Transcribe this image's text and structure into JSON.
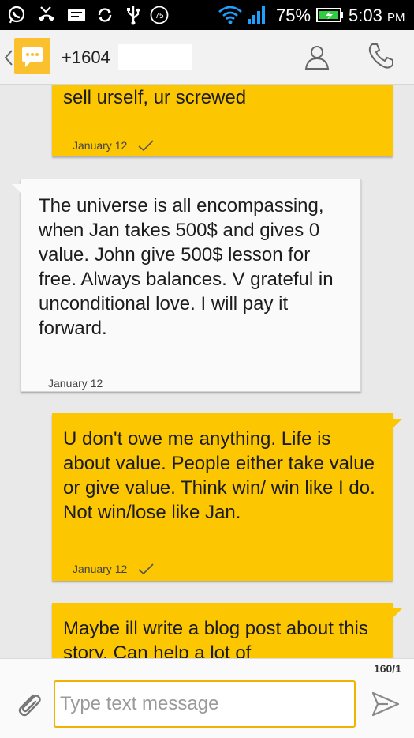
{
  "status_bar": {
    "notification_icons": [
      "whatsapp-icon",
      "missed-call-icon",
      "message-icon",
      "sync-icon",
      "usb-icon",
      "battery-level-badge-icon"
    ],
    "badge_value": "75",
    "battery_percent": "75%",
    "time": "5:03",
    "time_suffix": "PM"
  },
  "header": {
    "contact_number": "+1604",
    "icons": [
      "back-chevron-icon",
      "messaging-app-icon",
      "add-contact-icon",
      "phone-icon"
    ]
  },
  "messages": [
    {
      "direction": "outgoing",
      "text": "Persuasion and social skills. Can't sell urself, ur screwed",
      "date": "January 12",
      "delivered": true
    },
    {
      "direction": "incoming",
      "text": "The universe is all encompassing, when Jan takes 500$ and gives 0 value. John give 500$ lesson for free.  Always balances.  V grateful in unconditional love. I will pay it forward.",
      "date": "January 12"
    },
    {
      "direction": "outgoing",
      "text": "U don't owe me anything. Life is about value. People either take value or give value. Think win/ win like I do. Not win/lose like Jan.",
      "date": "January 12",
      "delivered": true
    },
    {
      "direction": "outgoing",
      "text": "Maybe ill write a blog post about this story. Can help a lot of"
    }
  ],
  "compose": {
    "char_counter": "160/1",
    "placeholder": "Type text message"
  },
  "colors": {
    "accent": "#fcc600",
    "incoming_bubble": "#fafafa",
    "background": "#e9e9e9"
  }
}
